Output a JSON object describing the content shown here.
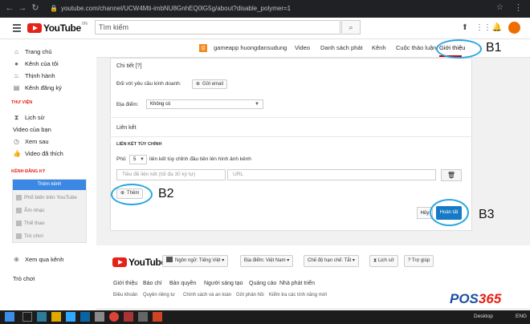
{
  "browser": {
    "url": "youtube.com/channel/UCW4Mti-imbNU8GnhEQ0lG5g/about?disable_polymer=1"
  },
  "header": {
    "logo": "YouTube",
    "region": "VN",
    "search_placeholder": "Tìm kiếm"
  },
  "sidebar": {
    "main": [
      "Trang chủ",
      "Kênh của tôi",
      "Thịnh hành",
      "Kênh đăng ký"
    ],
    "library_head": "THƯ VIỆN",
    "library": [
      "Lịch sử",
      "Video của bạn",
      "Xem sau",
      "Video đã thích"
    ],
    "subs_head": "KÊNH ĐĂNG KÝ",
    "browse_button": "Thêm kênh",
    "subs": [
      "Phổ biến trên YouTube",
      "Âm nhạc",
      "Thể thao",
      "Trò chơi"
    ],
    "more": "Xem qua kênh",
    "games": "Trò chơi"
  },
  "channel": {
    "avatar_letter": "g",
    "name": "gameapp huongdansudung",
    "tabs": [
      "Video",
      "Danh sách phát",
      "Kênh",
      "Cuộc thảo luận",
      "Giới thiệu"
    ]
  },
  "panel": {
    "details_title": "Chi tiết [?]",
    "business_label": "Đối với yêu cầu kinh doanh:",
    "email_button": "Gửi email",
    "location_label": "Địa điểm:",
    "location_value": "Không có",
    "links_title": "Liên kết",
    "custom_links_title": "LIÊN KẾT TÙY CHỈNH",
    "overlay_prefix": "Phủ",
    "overlay_count": "5",
    "overlay_suffix": "liên kết tùy chỉnh đầu tiên lên hình ảnh kênh",
    "link_title_placeholder": "Tiêu đề liên kết (tối đa 30 ký tự)",
    "url_placeholder": "URL",
    "add_button": "Thêm",
    "cancel_button": "Hủy",
    "done_button": "Hoàn tất"
  },
  "annotations": {
    "b1": "B1",
    "b2": "B2",
    "b3": "B3"
  },
  "footer": {
    "logo": "YouTube",
    "language": "Ngôn ngữ: Tiếng Việt",
    "location": "Địa điểm: Việt Nam",
    "restricted": "Chế độ hạn chế: Tắt",
    "history": "Lịch sử",
    "help": "Trợ giúp",
    "links1": [
      "Giới thiệu",
      "Báo chí",
      "Bản quyền",
      "Người sáng tạo",
      "Quảng cáo",
      "Nhà phát triển"
    ],
    "links2": [
      "Điều khoản",
      "Quyền riêng tư",
      "Chính sách và an toàn",
      "Gửi phản hồi",
      "Kiểm tra các tính năng mới"
    ]
  },
  "taskbar": {
    "desktop": "Desktop",
    "lang": "ENG"
  },
  "watermark": {
    "pos": "POS",
    "num": "365"
  },
  "colors": {
    "youtube_red": "#e62117",
    "annotation_blue": "#2aa6e0",
    "done_blue": "#167ac6"
  }
}
